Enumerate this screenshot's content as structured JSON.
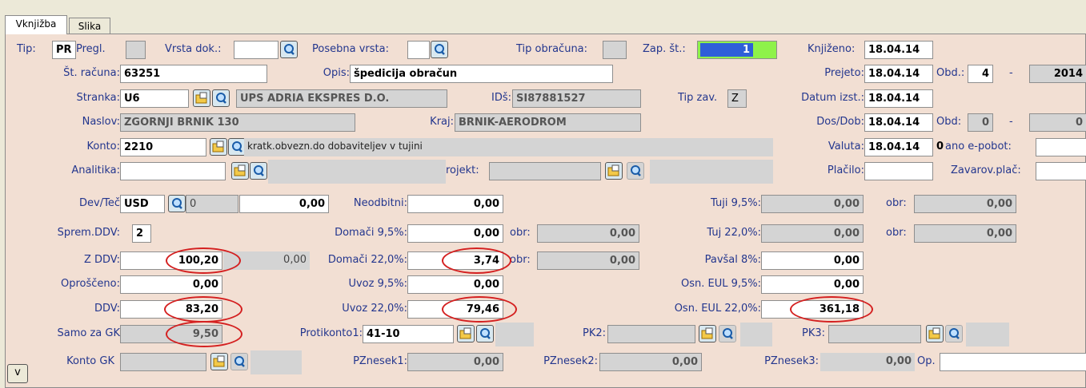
{
  "tabs": {
    "vknjizba": "Vknjižba",
    "slika": "Slika"
  },
  "labels": {
    "tip": "Tip:",
    "pregl": "Pregl.",
    "vrsta_dok": "Vrsta dok.:",
    "posebna_vrsta": "Posebna vrsta:",
    "tip_obracuna": "Tip obračuna:",
    "zap_st": "Zap. št.:",
    "knjizeno": "Knjiženo:",
    "st_racuna": "Št. računa:",
    "opis": "Opis:",
    "prejeto": "Prejeto:",
    "obd": "Obd.:",
    "dash": "-",
    "stranka": "Stranka:",
    "ids": "IDš:",
    "tip_zav": "Tip zav.",
    "datum_izst": "Datum izst.:",
    "naslov": "Naslov:",
    "kraj": "Kraj:",
    "dos_dob": "Dos/Dob:",
    "obd2": "Obd:",
    "konto": "Konto:",
    "valuta": "Valuta:",
    "ano_epobot": "ano e-pobot:",
    "analitika": "Analitika:",
    "projekt": "rojekt:",
    "placilo": "Plačilo:",
    "zavarov_plac": "Zavarov.plač:",
    "dev_tec": "Dev/Teč",
    "neodbitni": "Neodbitni:",
    "tuji_95": "Tuji 9,5%:",
    "obr": "obr:",
    "sprem_ddv": "Sprem.DDV:",
    "domaci_95": "Domači 9,5%:",
    "tuj_22": "Tuj 22,0%:",
    "z_ddv": "Z DDV:",
    "domaci_22": "Domači 22,0%:",
    "pavsal_8": "Pavšal 8%:",
    "oproisceno": "Oproščeno:",
    "uvoz_95": "Uvoz 9,5%:",
    "osn_eul_95": "Osn. EUL 9,5%:",
    "ddv": "DDV:",
    "uvoz_22": "Uvoz 22,0%:",
    "osn_eul_22": "Osn. EUL 22,0%:",
    "samo_za_gk": "Samo za GK",
    "protikonto1": "Protikonto1:",
    "pk2": "PK2:",
    "pk3": "PK3:",
    "konto_gk": "Konto GK",
    "pznesek1": "PZnesek1:",
    "pznesek2": "PZnesek2:",
    "pznesek3": "PZnesek3:",
    "op": "Op."
  },
  "values": {
    "tip": "PR",
    "pregl": "",
    "vrsta_dok": "",
    "posebna_vrsta": "",
    "tip_obracuna": "",
    "zap_st": "1",
    "knjizeno": "18.04.14",
    "st_racuna": "63251",
    "opis": "špedicija obračun",
    "prejeto": "18.04.14",
    "obd": "4",
    "obd_year": "2014",
    "stranka": "U6",
    "stranka_name": "UPS ADRIA EKSPRES D.O.",
    "ids": "SI87881527",
    "tip_zav": "Z",
    "datum_izst": "18.04.14",
    "naslov": "ZGORNJI BRNIK 130",
    "kraj": "BRNIK-AERODROM",
    "dos_dob": "18.04.14",
    "obd2": "0",
    "obd2_year": "0",
    "konto": "2210",
    "konto_desc": "kratk.obvezn.do dobaviteljev v tujini",
    "valuta": "18.04.14",
    "valuta_days": "0",
    "ano_epobot": "",
    "analitika": "",
    "projekt": "",
    "placilo": "",
    "zavarov_plac": "",
    "dev": "USD",
    "tec": "0",
    "dev_amount": "0,00",
    "neodbitni": "0,00",
    "tuji_95": "0,00",
    "tuji_95_obr": "0,00",
    "sprem_ddv": "2",
    "domaci_95": "0,00",
    "domaci_95_obr": "0,00",
    "tuj_22": "0,00",
    "tuj_22_obr": "0,00",
    "z_ddv": "100,20",
    "z_ddv_2": "0,00",
    "domaci_22": "3,74",
    "domaci_22_obr": "0,00",
    "pavsal_8": "0,00",
    "oproisceno": "0,00",
    "uvoz_95": "0,00",
    "osn_eul_95": "0,00",
    "ddv": "83,20",
    "uvoz_22": "79,46",
    "osn_eul_22": "361,18",
    "samo_za_gk": "9,50",
    "protikonto1": "41-10",
    "pk2": "",
    "pk3": "",
    "konto_gk": "",
    "pznesek1": "0,00",
    "pznesek2": "0,00",
    "pznesek3": "0,00",
    "op": ""
  },
  "bottom_button": "v",
  "icons": {
    "lookup": "magnifier-icon",
    "new": "folder-icon"
  },
  "colors": {
    "panel": "#f2dfd3",
    "label": "#23368e",
    "highlight": "#2e5fd8",
    "green": "#8ef24a",
    "ellipse": "#d42020"
  }
}
